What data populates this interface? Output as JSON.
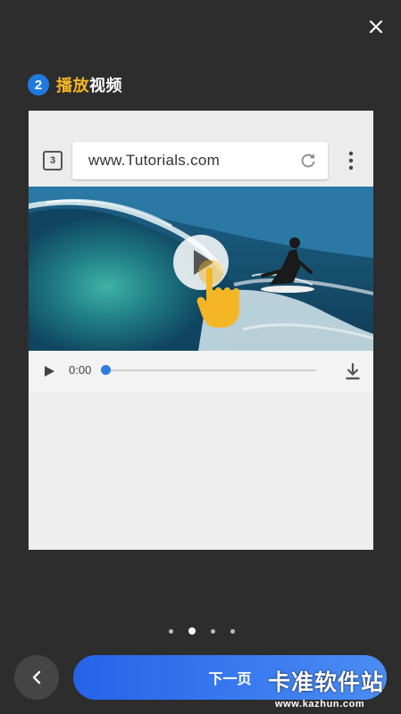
{
  "step": {
    "number": "2",
    "title_highlight": "播放",
    "title_rest": "视频"
  },
  "browser": {
    "tab_count": "3",
    "url": "www.Tutorials.com"
  },
  "player": {
    "time": "0:00",
    "progress": 0
  },
  "pager": {
    "total": 4,
    "active_index": 1
  },
  "buttons": {
    "next_label": "下一页"
  },
  "watermark": {
    "main": "卡准软件站",
    "sub": "www.kazhun.com"
  },
  "colors": {
    "background": "#2d2d2d",
    "accent_blue": "#1f7ae0",
    "highlight_yellow": "#f5b626"
  }
}
